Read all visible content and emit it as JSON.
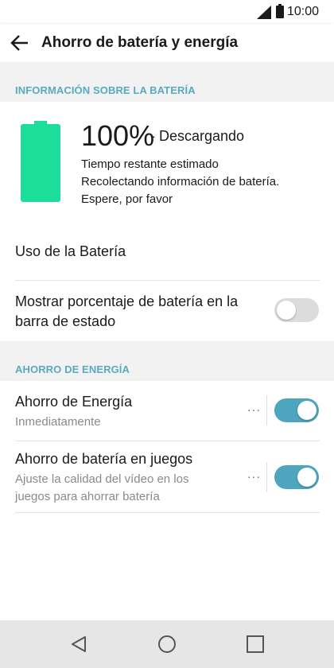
{
  "status_bar": {
    "time": "10:00",
    "icons": [
      "signal-icon",
      "battery-icon"
    ]
  },
  "app_bar": {
    "title": "Ahorro de batería y energía",
    "back_icon": "arrow-left-icon"
  },
  "battery_section": {
    "header": "INFORMACIÓN SOBRE LA BATERÍA",
    "percent": "100%",
    "status": "- Descargando",
    "estimate_lines": [
      "Tiempo restante estimado",
      "Recolectando información de batería.",
      "Espere, por favor"
    ],
    "battery_level": 1.0,
    "battery_color": "#1cde9a"
  },
  "battery_usage": {
    "label": "Uso de la Batería"
  },
  "show_percentage": {
    "label_line1": "Mostrar porcentaje de batería en la",
    "label_line2": "barra de estado",
    "enabled": false
  },
  "energy_section": {
    "header": "AHORRO DE ENERGÍA",
    "items": [
      {
        "title": "Ahorro de Energía",
        "subtitle": "Inmediatamente",
        "enabled": true,
        "more": "···"
      },
      {
        "title": "Ahorro de batería en juegos",
        "subtitle_line1": "Ajuste la calidad del vídeo en los",
        "subtitle_line2": "juegos para ahorrar batería",
        "enabled": true,
        "more": "···"
      }
    ]
  },
  "nav_bar": {
    "buttons": [
      "back-triangle-icon",
      "home-circle-icon",
      "recents-square-icon"
    ]
  },
  "colors": {
    "accent": "#4da6bd",
    "section_header_text": "#5aa9c0",
    "section_bg": "#f2f2f2",
    "nav_bg": "#e6e6e6"
  }
}
